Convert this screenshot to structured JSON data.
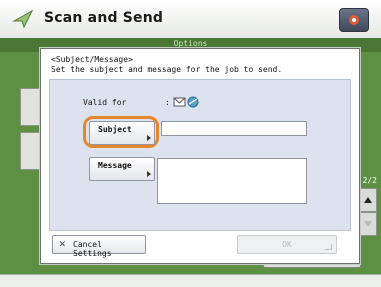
{
  "app": {
    "title": "Scan and Send",
    "options_label": "Options",
    "page_indicator": "2/2",
    "close_label": "Close"
  },
  "dialog": {
    "heading": "<Subject/Message>",
    "description": "Set the subject and message for the job to send.",
    "valid_for_label": "Valid for",
    "valid_for_colon": ":",
    "subject_button": "Subject",
    "subject_value": "",
    "message_button": "Message",
    "message_value": "",
    "cancel_button": "Cancel Settings",
    "ok_button": "OK"
  },
  "colors": {
    "accent_highlight": "#e8862a",
    "background_green": "#5d9042",
    "dialog_body": "#dde2ef"
  }
}
